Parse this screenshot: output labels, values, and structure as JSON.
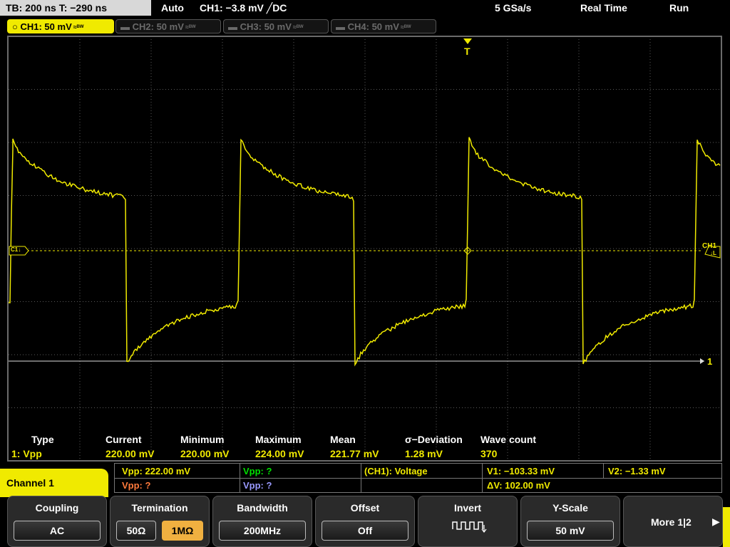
{
  "status": {
    "timebase": "TB: 200 ns   T: −290 ns",
    "mode": "Auto",
    "trigger": "CH1: −3.8 mV ╱DC",
    "sample_rate": "5 GSa/s",
    "acq": "Real Time",
    "run": "Run"
  },
  "channels": [
    {
      "label": "CH1: 50 mV",
      "suffix": "≈ᴮᵂ"
    },
    {
      "label": "CH2: 50 mV",
      "suffix": "≈ᴮᵂ"
    },
    {
      "label": "CH3: 50 mV",
      "suffix": "≈ᴮᵂ"
    },
    {
      "label": "CH4: 50 mV",
      "suffix": "≈ᴮᵂ"
    }
  ],
  "markers": {
    "trigger": "T",
    "ch1_ref": "C1↓",
    "ch1_right": "CH1",
    "ch1_right_sub": "↓L",
    "cursor_level": "1"
  },
  "measure": {
    "headers": [
      "Type",
      "Current",
      "Minimum",
      "Maximum",
      "Mean",
      "σ−Deviation",
      "Wave count"
    ],
    "values": [
      "1: Vpp",
      "220.00 mV",
      "220.00 mV",
      "224.00 mV",
      "221.77 mV",
      "1.28 mV",
      "370"
    ]
  },
  "panel": {
    "title": "Channel 1",
    "vpp_ch1": "Vpp: 222.00 mV",
    "vpp_ch2": "Vpp: ?",
    "vpp_ch3": "Vpp: ?",
    "vpp_ch4": "Vpp: ?",
    "cursor_source": "(CH1): Voltage",
    "v1": "V1: −103.33 mV",
    "v2": "V2: −1.33 mV",
    "dv": "ΔV: 102.00 mV"
  },
  "softkeys": {
    "coupling": {
      "title": "Coupling",
      "value": "AC"
    },
    "termination": {
      "title": "Termination",
      "opt1": "50Ω",
      "opt2": "1MΩ"
    },
    "bandwidth": {
      "title": "Bandwidth",
      "value": "200MHz"
    },
    "offset": {
      "title": "Offset",
      "value": "Off"
    },
    "invert": {
      "title": "Invert"
    },
    "yscale": {
      "title": "Y-Scale",
      "value": "50 mV"
    },
    "more": {
      "label": "More 1|2"
    }
  },
  "colors": {
    "ch1": "#f0ea00",
    "ch2": "#00e000",
    "ch3": "#ff7a3c",
    "ch4": "#9a9aff",
    "grid": "#6b6b6b"
  }
}
